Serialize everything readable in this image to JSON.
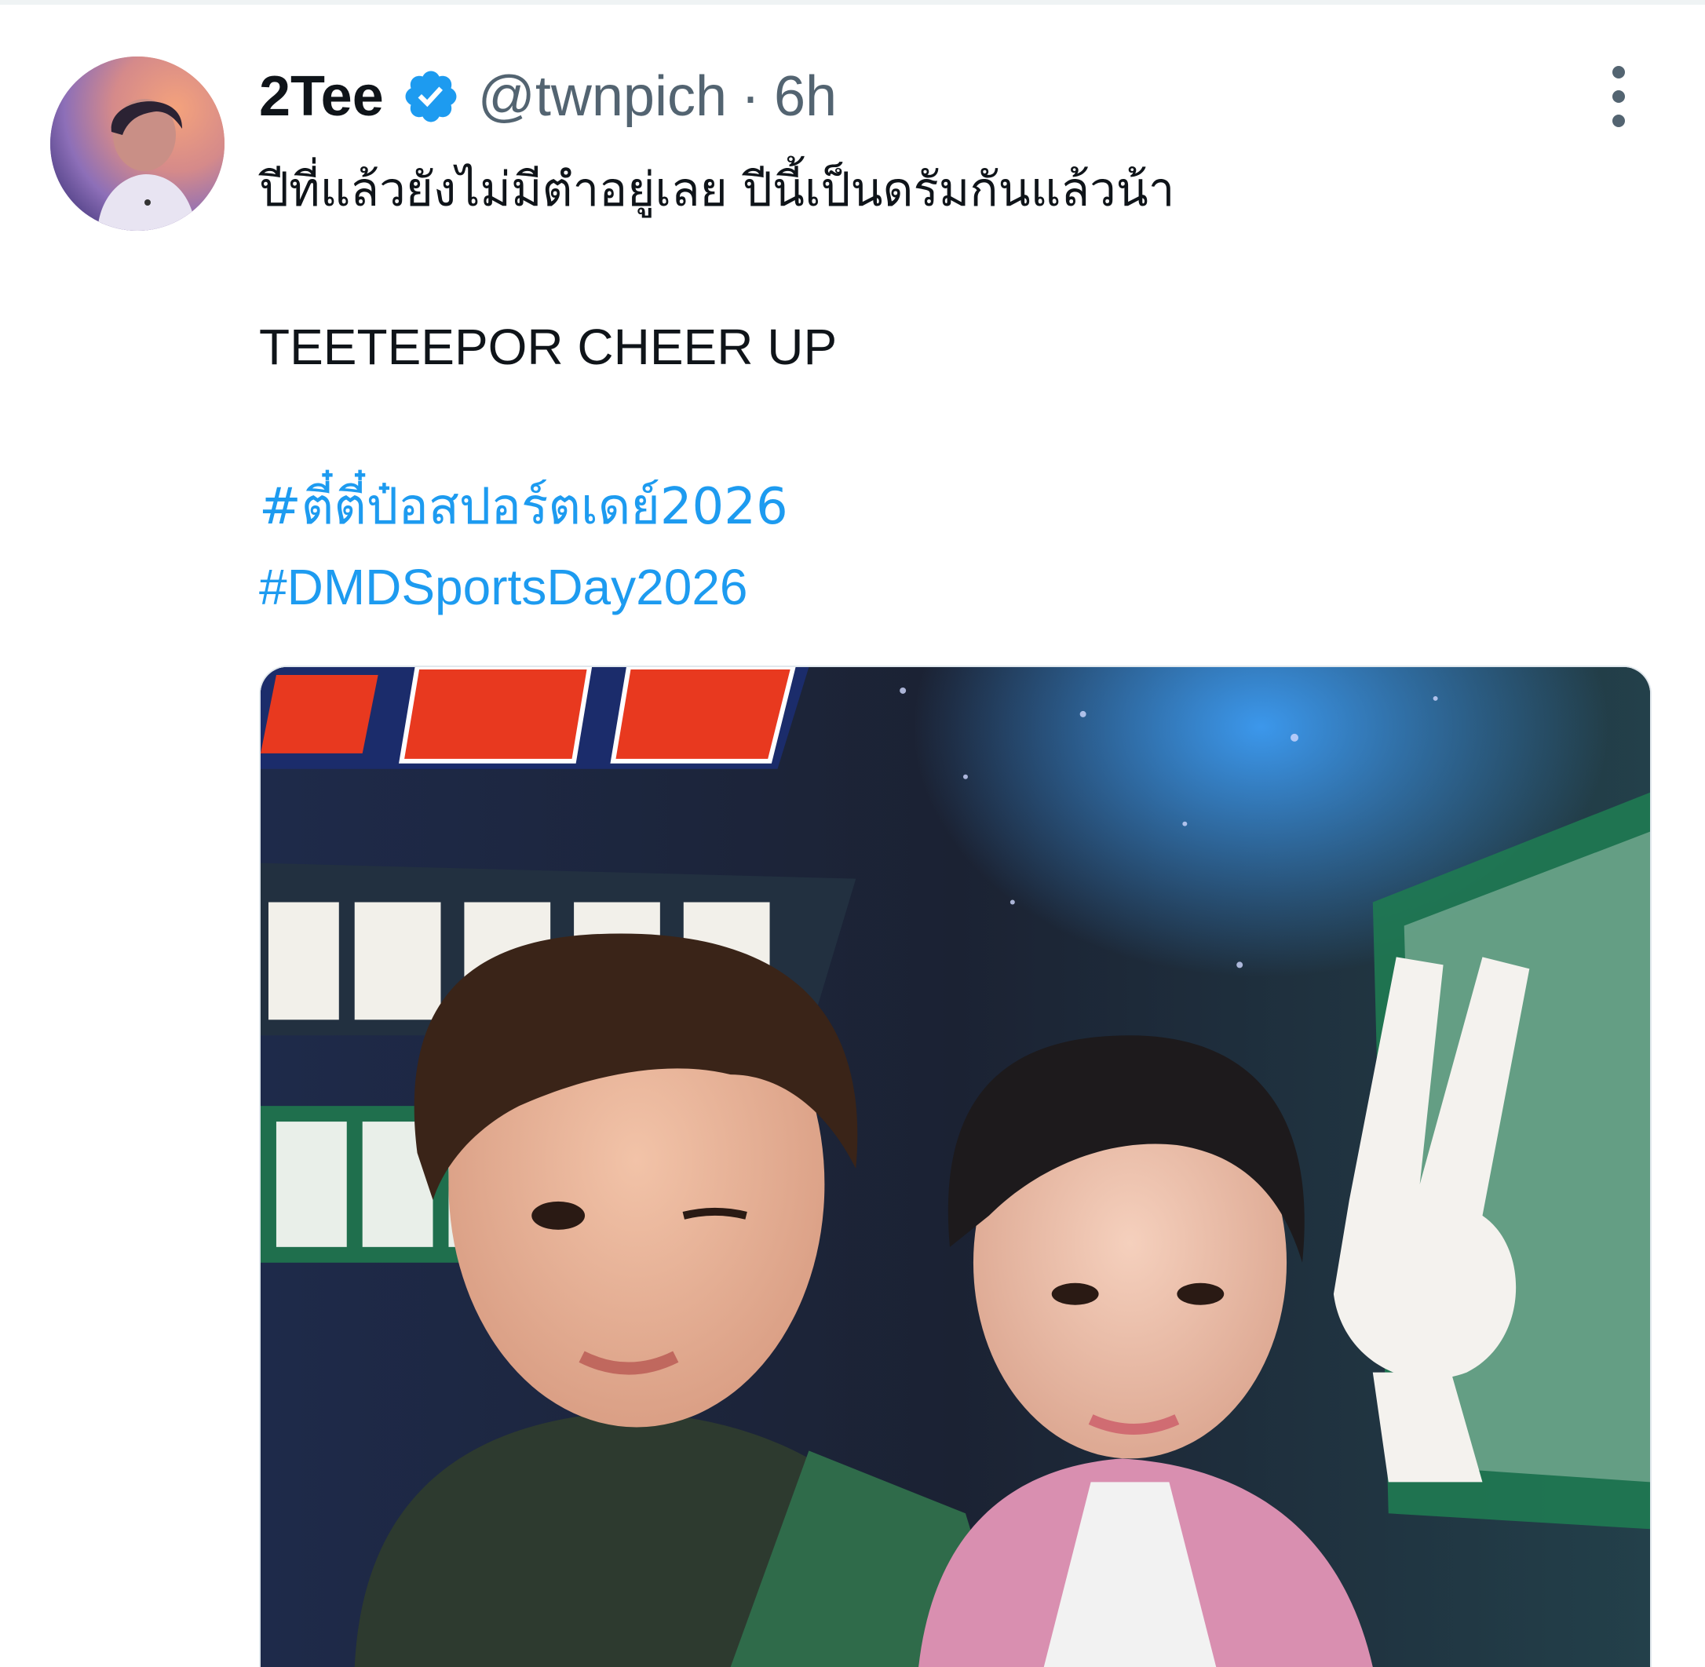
{
  "tweet": {
    "display_name": "2Tee",
    "verified": true,
    "handle": "@twnpich",
    "separator": "·",
    "time": "6h",
    "text_line_1": "ปีที่แล้วยังไม่มีตำอยู่เลย ปีนี้เป็นดรัมกันแล้วน้า",
    "text_line_2": "TEETEEPOR CHEER UP",
    "hashtags": [
      "#ตี๋ตี๋ป๋อสปอร์ตเดย์2026",
      "#DMDSportsDay2026"
    ]
  },
  "icons": {
    "verified_badge": "verified-check-icon",
    "more_menu": "more-vertical-icon"
  },
  "colors": {
    "link": "#1d9bf0",
    "secondary_text": "#536471",
    "primary_text": "#0f1419"
  }
}
